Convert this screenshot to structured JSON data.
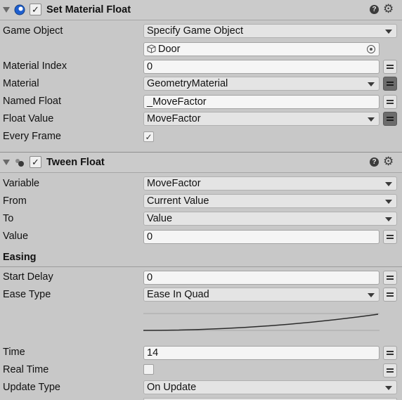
{
  "set_material_float": {
    "title": "Set Material Float",
    "enabled_check": "✓",
    "help": "?",
    "gear": "⚙",
    "icon": "globe-icon",
    "rows": {
      "game_object_label": "Game Object",
      "game_object_value": "Specify Game Object",
      "object_ref": "Door",
      "material_index_label": "Material Index",
      "material_index_value": "0",
      "material_label": "Material",
      "material_value": "GeometryMaterial",
      "named_float_label": "Named Float",
      "named_float_value": "_MoveFactor",
      "float_value_label": "Float Value",
      "float_value_value": "MoveFactor",
      "every_frame_label": "Every Frame",
      "every_frame_check": "✓"
    }
  },
  "tween_float": {
    "title": "Tween Float",
    "enabled_check": "✓",
    "help": "?",
    "gear": "⚙",
    "icon": "tween-icon",
    "rows": {
      "variable_label": "Variable",
      "variable_value": "MoveFactor",
      "from_label": "From",
      "from_value": "Current Value",
      "to_label": "To",
      "to_value": "Value",
      "value_label": "Value",
      "value_value": "0",
      "easing_header": "Easing",
      "start_delay_label": "Start Delay",
      "start_delay_value": "0",
      "ease_type_label": "Ease Type",
      "ease_type_value": "Ease In Quad",
      "time_label": "Time",
      "time_value": "14",
      "real_time_label": "Real Time",
      "update_type_label": "Update Type",
      "update_type_value": "On Update"
    }
  },
  "colors": {
    "panel_bg": "#c8c8c8",
    "field_bg": "#f5f5f5",
    "dropdown_bg": "#e4e4e4",
    "active_variable_button": "#6c6c6c",
    "header_icon_blue": "#1f5fcf"
  }
}
